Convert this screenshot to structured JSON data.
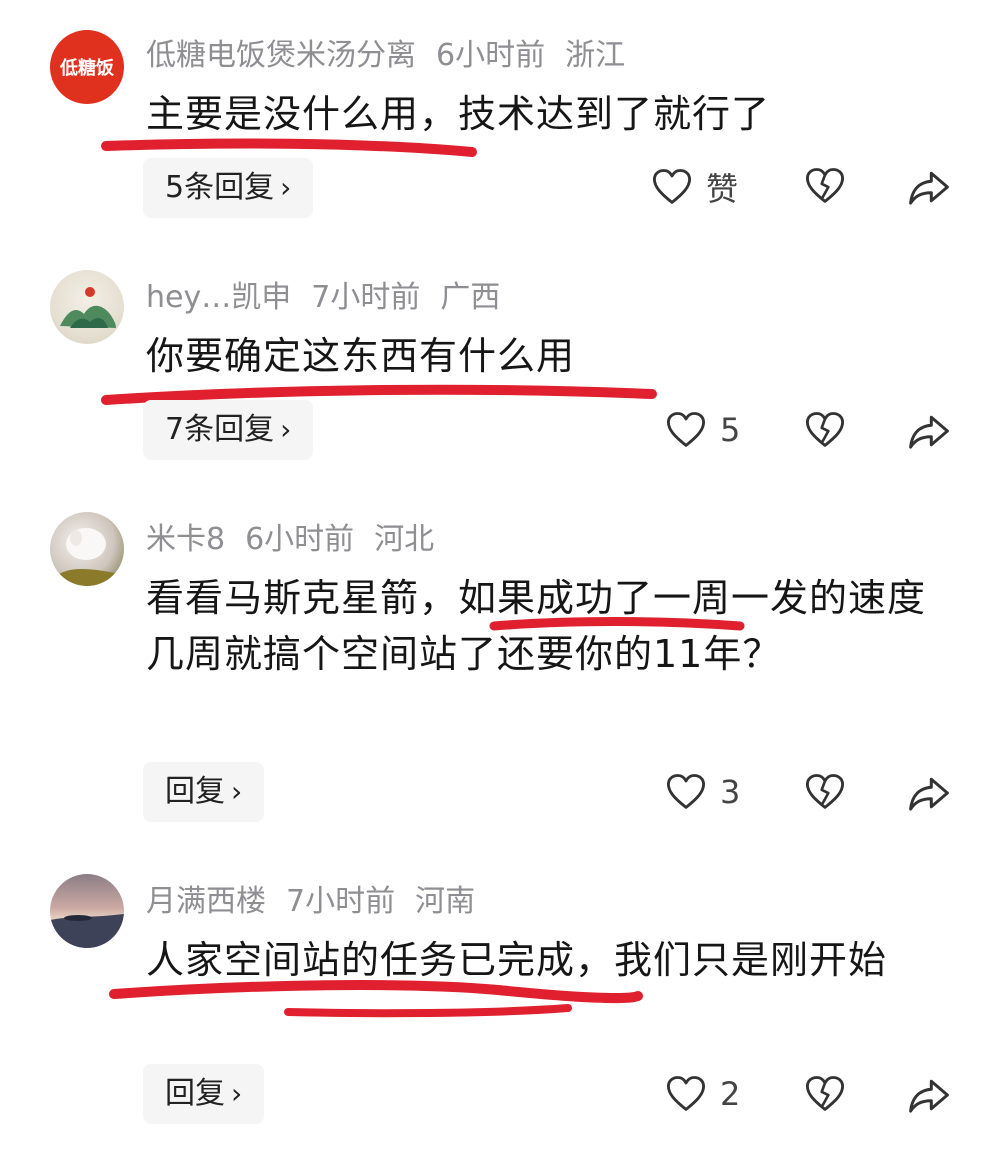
{
  "comments": [
    {
      "avatar_text": "低糖饭",
      "username": "低糖电饭煲米汤分离",
      "time": "6小时前",
      "location": "浙江",
      "text": "主要是没什么用，技术达到了就行了",
      "reply_label": "5条回复",
      "like_count": "赞"
    },
    {
      "username": "hey…凯申",
      "time": "7小时前",
      "location": "广西",
      "text": "你要确定这东西有什么用",
      "reply_label": "7条回复",
      "like_count": "5"
    },
    {
      "username": "米卡8",
      "time": "6小时前",
      "location": "河北",
      "text": "看看马斯克星箭，如果成功了一周一发的速度几周就搞个空间站了还要你的11年？",
      "reply_label": "回复",
      "like_count": "3"
    },
    {
      "username": "月满西楼",
      "time": "7小时前",
      "location": "河南",
      "text": "人家空间站的任务已完成，我们只是刚开始",
      "reply_label": "回复",
      "like_count": "2"
    }
  ],
  "icons": {
    "like": "heart-outline-icon",
    "dislike": "broken-heart-icon",
    "share": "share-arrow-icon",
    "reply_chevron": "chevron-right-icon"
  },
  "colors": {
    "underline": "#e0202e",
    "meta_text": "#8e8e93",
    "reply_bg": "#f5f5f5"
  }
}
